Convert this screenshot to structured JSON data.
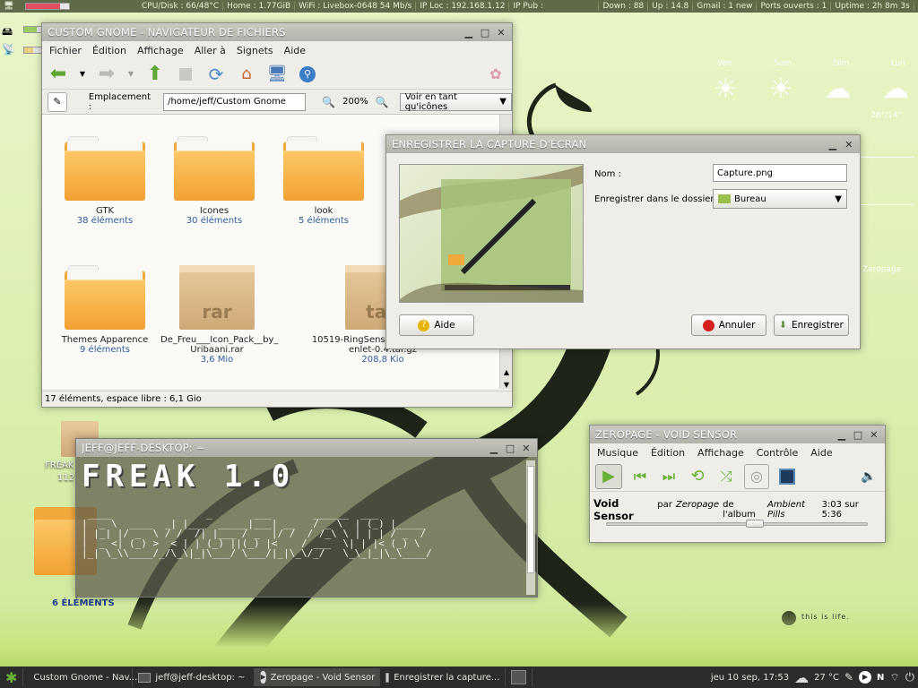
{
  "topbar": {
    "items": [
      "CPU/Disk : 66/48°C",
      "Home : 1.77GiB",
      "WiFi : Livebox-0648 54 Mb/s",
      "IP Loc : 192.168.1.12",
      "IP Pub : ",
      "Down : 88",
      "Up : 14.8",
      "Gmail : 1 new",
      "Ports ouverts : 1",
      "Uptime : 2h 8m 3s"
    ]
  },
  "weather": {
    "days": [
      "Ven",
      "Sam",
      "Dim",
      "Lun"
    ],
    "temps": [
      "",
      "",
      "",
      "28°/14°"
    ],
    "label": "Zeropage"
  },
  "file_manager": {
    "title": "CUSTOM GNOME - NAVIGATEUR DE FICHIERS",
    "menu": [
      "Fichier",
      "Édition",
      "Affichage",
      "Aller à",
      "Signets",
      "Aide"
    ],
    "location_label": "Emplacement :",
    "location_value": "/home/jeff/Custom Gnome",
    "zoom": "200%",
    "view_mode": "Voir en tant qu'icônes",
    "items": [
      {
        "name": "GTK",
        "info": "38 éléments",
        "kind": "folder"
      },
      {
        "name": "Icones",
        "info": "30 éléments",
        "kind": "folder"
      },
      {
        "name": "look",
        "info": "5 éléments",
        "kind": "folder"
      },
      {
        "name": "Themes Apparence",
        "info": "9 éléments",
        "kind": "folder"
      },
      {
        "name": "De_Freu___Icon_Pack__by_ Uribaani.rar",
        "info": "3,6 Mio",
        "kind": "archive",
        "ext": "rar"
      },
      {
        "name": "10519-RingSensorsHotifiedScreenlet-0.4.tar.gz",
        "info": "208,8 Kio",
        "kind": "archive",
        "ext": "tar."
      }
    ],
    "status": "17 éléments, espace libre : 6,1 Gio"
  },
  "screenshot_dialog": {
    "title": "ENREGISTRER LA CAPTURE D'ÉCRAN",
    "name_label": "Nom :",
    "name_value": "Capture.png",
    "folder_label": "Enregistrer dans le dossier :",
    "folder_value": "Bureau",
    "help": "Aide",
    "cancel": "Annuler",
    "save": "Enregistrer"
  },
  "player": {
    "title": "ZEROPAGE - VOID SENSOR",
    "menu": [
      "Musique",
      "Édition",
      "Affichage",
      "Contrôle",
      "Aide"
    ],
    "track": "Void Sensor",
    "by": "par",
    "artist": "Zeropage",
    "of_album": "de l'album",
    "album": "Ambient Pills",
    "time": "3:03 sur 5:36",
    "progress": 0.57
  },
  "terminal": {
    "title": "JEFF@JEFF-DESKTOP: ~",
    "banner": "FREAK 1.0",
    "ascii": " ____                _       ___       ______  ___  \n|  _ \\  ____  _| |___  _____|___| __   / _ \\  | (_) |_____\n| |_| |/ _  \\ / /  /| |___ / _  |/ /  / /_\\ \\ | | | / _  /\n|  _ <| (_) >  < | | (_) ||(_) |<    / ___  \\| | |< (_) \\\n|_| \\_\\\\____/_/\\_\\|_|\\___/ \\___/|_|\\_\\/_/   \\_\\_|_|\\_\\____/"
  },
  "desktop": {
    "icons": [
      {
        "name": "FREAK",
        "info": "112"
      },
      {
        "name": "",
        "info": "6 ÉLÉMENTS"
      }
    ],
    "watermark": "this is life."
  },
  "taskbar": {
    "tasks": [
      "Custom Gnome - Nav...",
      "jeff@jeff-desktop: ~",
      "Zeropage - Void Sensor",
      "Enregistrer la capture..."
    ],
    "clock": "jeu 10 sep, 17:53",
    "temp": "27 °C"
  }
}
